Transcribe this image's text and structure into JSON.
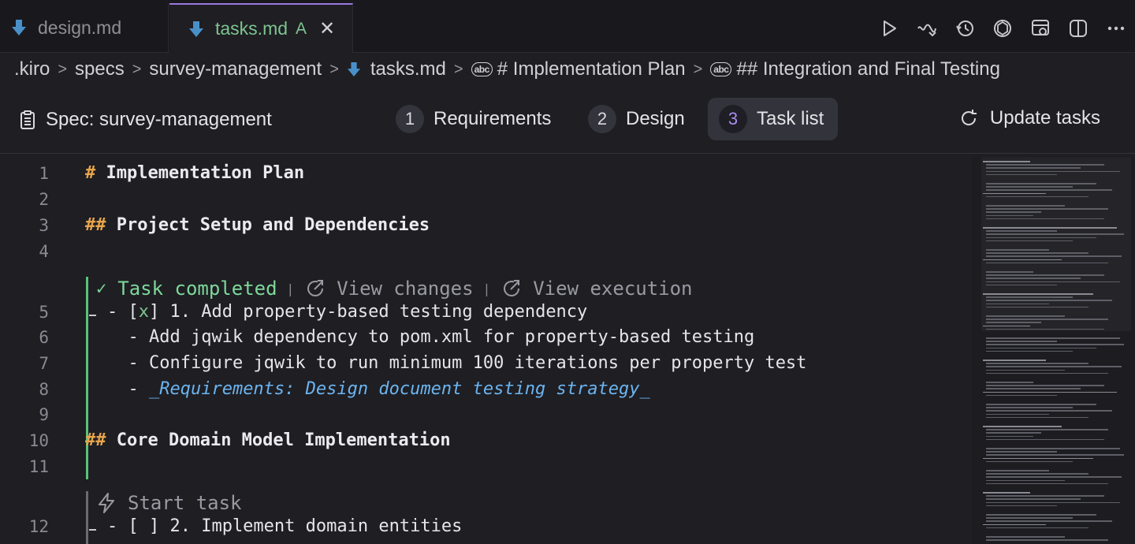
{
  "tabs": [
    {
      "label": "design.md",
      "active": false
    },
    {
      "label": "tasks.md",
      "active": true,
      "status": "A"
    }
  ],
  "tab_actions": [
    "play-icon",
    "voice-icon",
    "history-icon",
    "openai-icon",
    "preview-icon",
    "split-editor-icon",
    "more-icon"
  ],
  "breadcrumb": {
    "items": [
      ".kiro",
      "specs",
      "survey-management",
      "tasks.md",
      "# Implementation Plan",
      "## Integration and Final Testing"
    ],
    "sep": ">"
  },
  "spec": {
    "title": "Spec: survey-management",
    "steps": [
      {
        "num": "1",
        "label": "Requirements"
      },
      {
        "num": "2",
        "label": "Design"
      },
      {
        "num": "3",
        "label": "Task list",
        "active": true
      }
    ],
    "update_label": "Update tasks"
  },
  "editor": {
    "lines": [
      {
        "n": "1",
        "hash": "#",
        "text": " Implementation Plan"
      },
      {
        "n": "2",
        "text": ""
      },
      {
        "n": "3",
        "hash": "##",
        "text": " Project Setup and Dependencies"
      },
      {
        "n": "4",
        "text": ""
      },
      {
        "n": "5",
        "pre": "- [",
        "x": "x",
        "text": "] 1. Add property-based testing dependency"
      },
      {
        "n": "6",
        "text": "  - Add jqwik dependency to pom.xml for property-based testing"
      },
      {
        "n": "7",
        "text": "  - Configure jqwik to run minimum 100 iterations per property test"
      },
      {
        "n": "8",
        "pre": "  - ",
        "link": "_Requirements: Design document testing strategy_"
      },
      {
        "n": "9",
        "text": ""
      },
      {
        "n": "10",
        "hash": "##",
        "text": " Core Domain Model Implementation"
      },
      {
        "n": "11",
        "text": ""
      },
      {
        "n": "12",
        "text": "- [ ] 2. Implement domain entities"
      }
    ],
    "lens_completed": {
      "status": "Task completed",
      "sep": "|",
      "view_changes": "View changes",
      "view_execution": "View execution"
    },
    "lens_start": {
      "label": "Start task"
    }
  },
  "colors": {
    "accent": "#9a7ae0",
    "completed_green": "#5bc27a",
    "heading_hash": "#e8a54b",
    "link_blue": "#6cb4f0"
  }
}
